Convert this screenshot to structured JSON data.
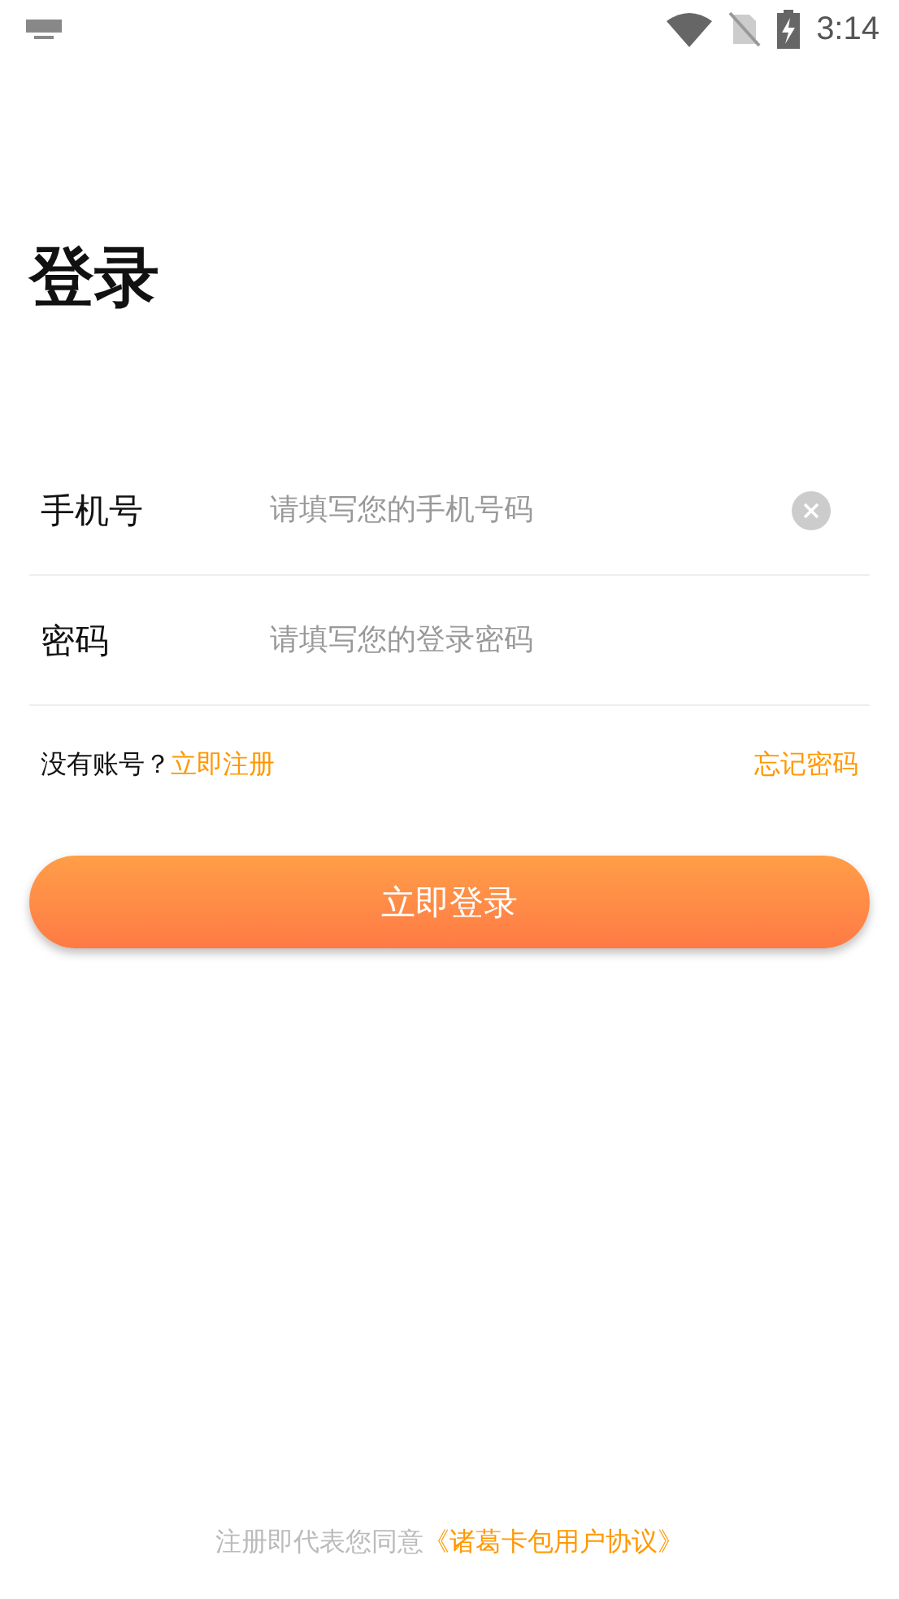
{
  "status_bar": {
    "time": "3:14"
  },
  "title": "登录",
  "fields": [
    {
      "label": "手机号",
      "placeholder": "请填写您的手机号码",
      "clearable": true
    },
    {
      "label": "密码",
      "placeholder": "请填写您的登录密码",
      "clearable": false
    }
  ],
  "register_prompt": {
    "text": "没有账号？",
    "link": "立即注册"
  },
  "forgot_link": "忘记密码",
  "login_button": "立即登录",
  "agreement": {
    "text": "注册即代表您同意",
    "link": "《诸葛卡包用户协议》"
  }
}
